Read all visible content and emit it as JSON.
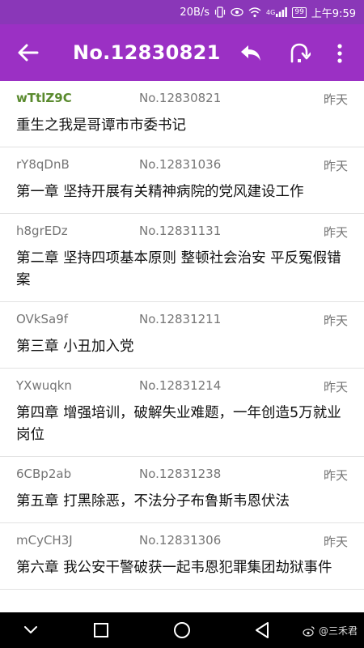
{
  "status_bar": {
    "net_speed": "20B/s",
    "signal_label": "4G",
    "battery": "99",
    "time": "上午9:59"
  },
  "app_bar": {
    "title": "No.12830821",
    "icons": [
      "back-arrow-icon",
      "reply-icon",
      "merge-icon",
      "more-vert-icon"
    ]
  },
  "messages": [
    {
      "code": "wTtlZ9C",
      "number": "No.12830821",
      "date": "昨天",
      "subject": "重生之我是哥谭市市委书记"
    },
    {
      "code": "rY8qDnB",
      "number": "No.12831036",
      "date": "昨天",
      "subject": "第一章 坚持开展有关精神病院的党风建设工作"
    },
    {
      "code": "h8grEDz",
      "number": "No.12831131",
      "date": "昨天",
      "subject": "第二章 坚持四项基本原则 整顿社会治安 平反冤假错案"
    },
    {
      "code": "OVkSa9f",
      "number": "No.12831211",
      "date": "昨天",
      "subject": "第三章 小丑加入党"
    },
    {
      "code": "YXwuqkn",
      "number": "No.12831214",
      "date": "昨天",
      "subject": "第四章 增强培训，破解失业难题，一年创造5万就业岗位"
    },
    {
      "code": "6CBp2ab",
      "number": "No.12831238",
      "date": "昨天",
      "subject": "第五章 打黑除恶，不法分子布鲁斯韦恩伏法"
    },
    {
      "code": "mCyCH3J",
      "number": "No.12831306",
      "date": "昨天",
      "subject": "第六章 我公安干警破获一起韦恩犯罪集团劫狱事件"
    }
  ],
  "nav_bar": {
    "icons": [
      "chevron-down-icon",
      "recent-apps-icon",
      "home-icon",
      "back-triangle-icon"
    ],
    "watermark": "@三禾君"
  },
  "colors": {
    "app_bar": "#9b30c4",
    "status_bar": "#8a37b8",
    "op_code": "#5a8a2e"
  }
}
